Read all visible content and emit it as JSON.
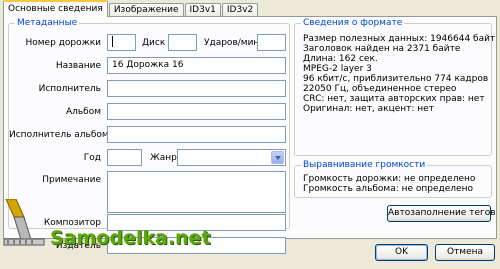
{
  "tabs": [
    {
      "label": "Основные сведения",
      "active": true
    },
    {
      "label": "Изображение",
      "active": false
    },
    {
      "label": "ID3v1",
      "active": false
    },
    {
      "label": "ID3v2",
      "active": false
    }
  ],
  "metadata": {
    "title": "Метаданные",
    "track_label": "Номер дорожки",
    "track_value": "",
    "disc_label": "Диск",
    "disc_value": "",
    "bpm_label": "Ударов/мин.",
    "bpm_value": "",
    "name_label": "Название",
    "name_value": "16 Дорожка 16",
    "artist_label": "Исполнитель",
    "artist_value": "",
    "album_label": "Альбом",
    "album_value": "",
    "album_artist_label": "Исполнитель альбома",
    "album_artist_value": "",
    "year_label": "Год",
    "year_value": "",
    "genre_label": "Жанр",
    "genre_value": "",
    "comment_label": "Примечание",
    "comment_value": "",
    "composer_label": "Композитор",
    "composer_value": "",
    "publisher_label": "Издатель",
    "publisher_value": ""
  },
  "format_info": {
    "title": "Сведения о формате",
    "lines": [
      "Размер полезных данных: 1946644 байт",
      "Заголовок найден на 2371 байте",
      "Длина: 162 сек.",
      "MPEG-2 layer 3",
      "96 кбит/с, приблизительно 774 кадров",
      "22050 Гц, объединенное стерео",
      "CRC: нет, защита авторских прав: нет",
      "Оригинал: нет, акцент: нет"
    ]
  },
  "volume": {
    "title": "Выравнивание громкости",
    "lines": [
      "Громкость дорожки: не определено",
      "Громкость альбома: не определено"
    ]
  },
  "buttons": {
    "autofill": "Автозаполнение тегов",
    "ok": "OK",
    "cancel": "Отмена"
  },
  "watermark": "Samodelka.net",
  "colors": {
    "group_title": "#0046d5",
    "tab_highlight": "#ffc83c",
    "window_bg": "#ece9d8",
    "watermark": "#5ca70c"
  }
}
